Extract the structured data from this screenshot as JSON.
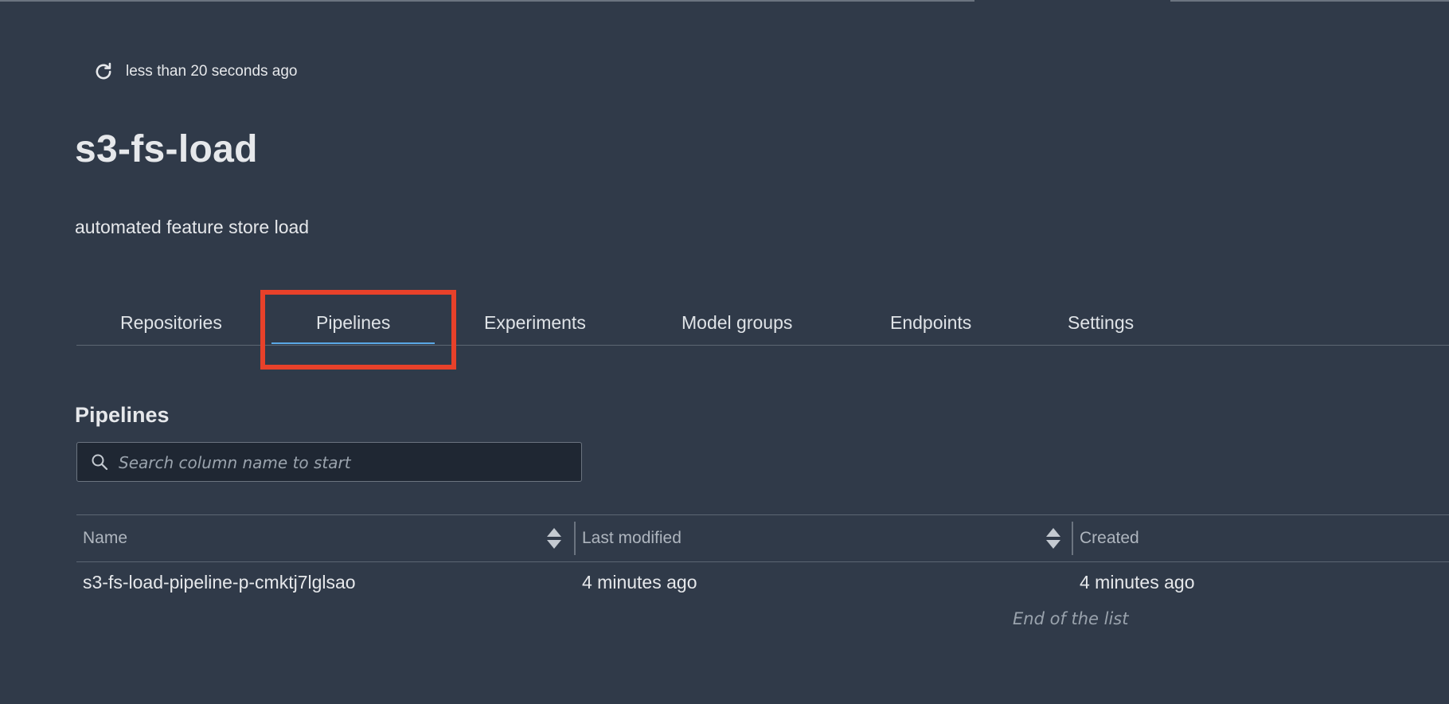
{
  "refresh": {
    "label": "less than 20 seconds ago",
    "icon": "refresh-icon"
  },
  "project": {
    "title": "s3-fs-load",
    "description": "automated feature store load"
  },
  "tabs": [
    {
      "label": "Repositories",
      "active": false
    },
    {
      "label": "Pipelines",
      "active": true
    },
    {
      "label": "Experiments",
      "active": false
    },
    {
      "label": "Model groups",
      "active": false
    },
    {
      "label": "Endpoints",
      "active": false
    },
    {
      "label": "Settings",
      "active": false
    }
  ],
  "pipelines": {
    "title": "Pipelines",
    "search": {
      "placeholder": "Search column name to start",
      "value": "",
      "icon": "search-icon"
    },
    "columns": [
      {
        "label": "Name",
        "sortable": true
      },
      {
        "label": "Last modified",
        "sortable": true
      },
      {
        "label": "Created",
        "sortable": false
      }
    ],
    "rows": [
      {
        "name": "s3-fs-load-pipeline-p-cmktj7lglsao",
        "last_modified": "4 minutes ago",
        "created": "4 minutes ago"
      }
    ],
    "end_of_list": "End of the list"
  },
  "colors": {
    "background": "#303a49",
    "highlight": "#e8412a",
    "active_tab_underline": "#5aa8e6"
  }
}
